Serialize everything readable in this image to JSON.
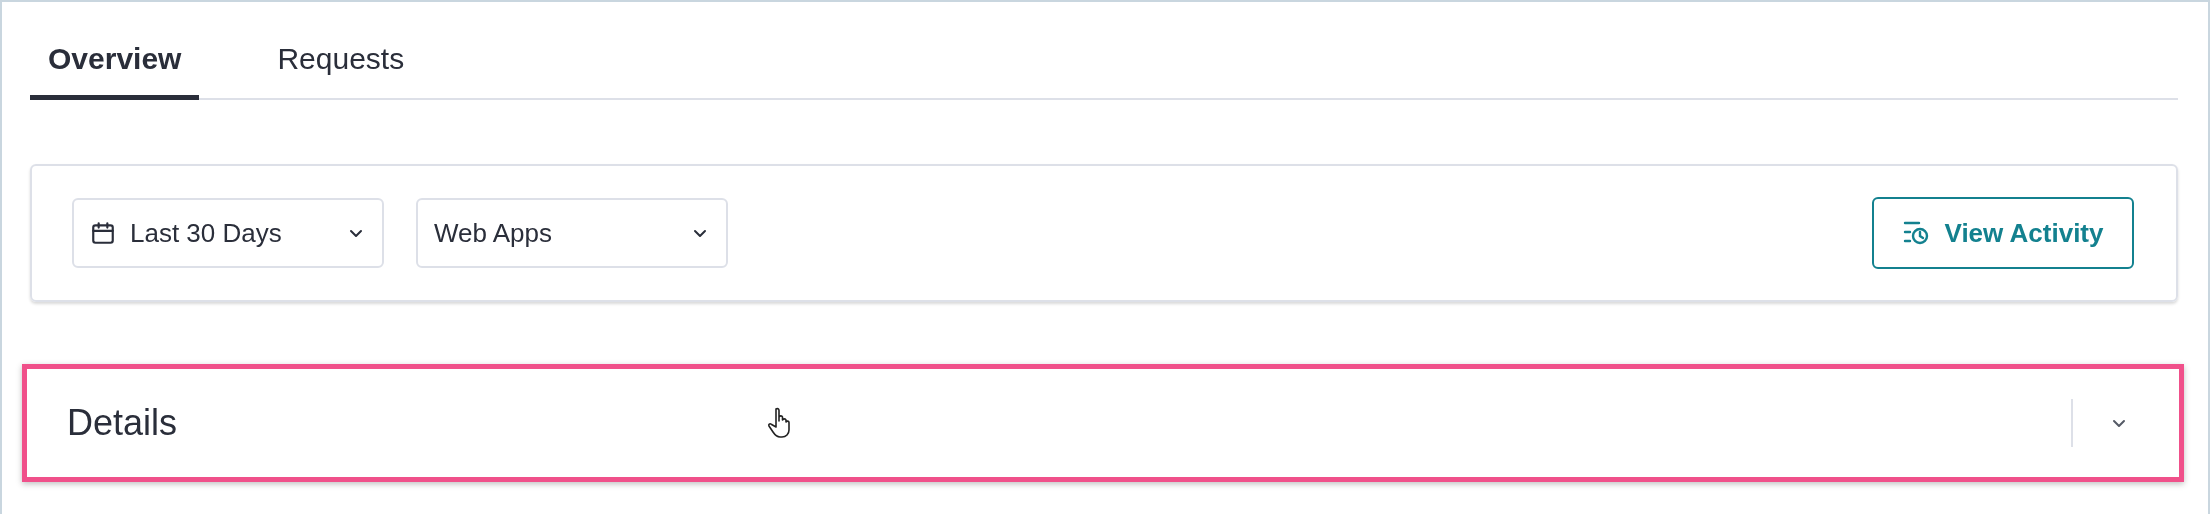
{
  "tabs": [
    {
      "label": "Overview",
      "selected": true
    },
    {
      "label": "Requests",
      "selected": false
    }
  ],
  "filters": {
    "date_range": {
      "value": "Last 30 Days"
    },
    "app_type": {
      "value": "Web Apps"
    },
    "view_activity": {
      "label": "View Activity"
    }
  },
  "details_panel": {
    "title": "Details",
    "expanded": false,
    "highlighted": true
  }
}
